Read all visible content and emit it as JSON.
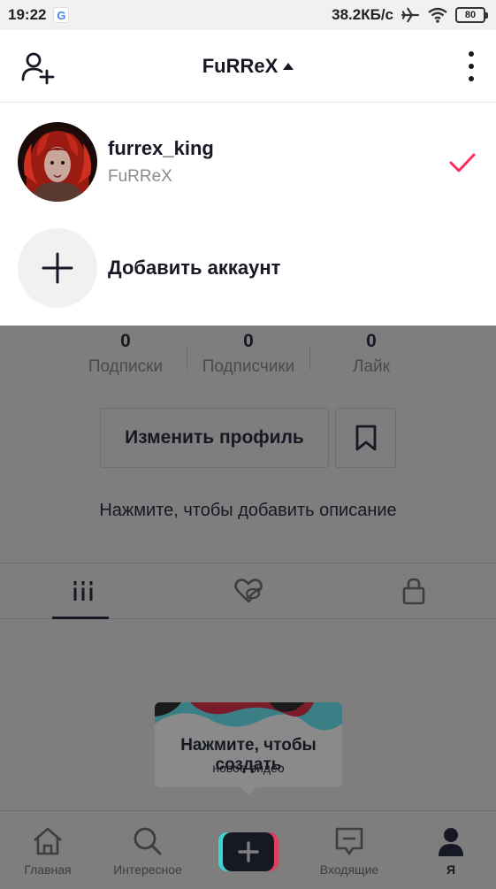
{
  "status_bar": {
    "time": "19:22",
    "app_icon": "G",
    "net_speed": "38.2КБ/с",
    "battery": "80"
  },
  "header": {
    "title": "FuRReX"
  },
  "accounts": {
    "current": {
      "username": "furrex_king",
      "display_name": "FuRReX"
    },
    "add_label": "Добавить аккаунт"
  },
  "profile": {
    "stats": [
      {
        "value": "0",
        "label": "Подписки"
      },
      {
        "value": "0",
        "label": "Подписчики"
      },
      {
        "value": "0",
        "label": "Лайк"
      }
    ],
    "edit_label": "Изменить профиль",
    "bio_hint": "Нажмите, чтобы добавить описание"
  },
  "tooltip": {
    "title": "Нажмите, чтобы создать",
    "subtitle": "новое видео"
  },
  "nav": {
    "home": "Главная",
    "discover": "Интересное",
    "inbox": "Входящие",
    "me": "Я"
  },
  "colors": {
    "accent": "#fe2c55",
    "cyan": "#25f4ee",
    "text": "#161823"
  }
}
